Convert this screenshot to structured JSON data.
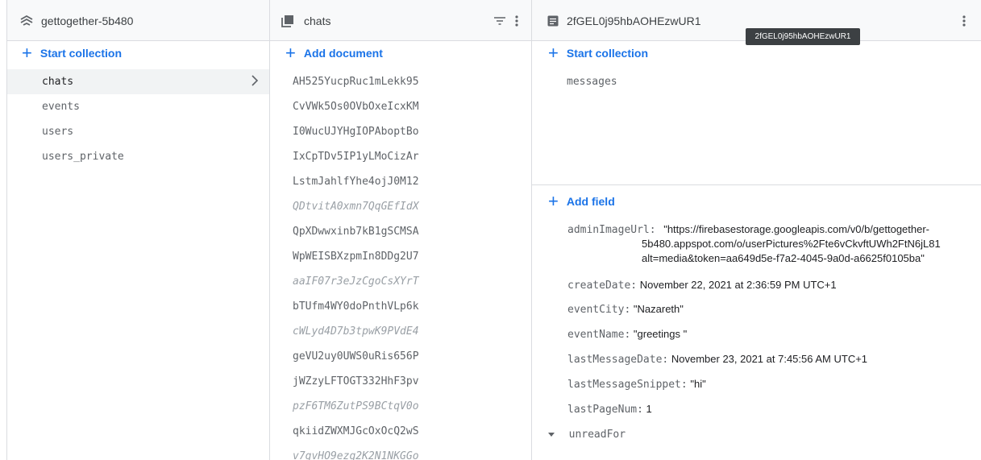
{
  "project": {
    "name": "gettogether-5b480"
  },
  "collections_panel": {
    "start_collection_label": "Start collection",
    "items": [
      {
        "label": "chats",
        "active": true
      },
      {
        "label": "events"
      },
      {
        "label": "users"
      },
      {
        "label": "users_private"
      }
    ]
  },
  "documents_panel": {
    "title": "chats",
    "add_document_label": "Add document",
    "items": [
      {
        "id": "AH525YucpRuc1mLekk95"
      },
      {
        "id": "CvVWk5Os0OVbOxeIcxKM"
      },
      {
        "id": "I0WucUJYHgIOPAboptBo"
      },
      {
        "id": "IxCpTDv5IP1yLMoCizAr"
      },
      {
        "id": "LstmJahlfYhe4ojJ0M12"
      },
      {
        "id": "QDtvitA0xmn7QqGEfIdX",
        "missing": true
      },
      {
        "id": "QpXDwwxinb7kB1gSCMSA"
      },
      {
        "id": "WpWEISBXzpmIn8DDg2U7"
      },
      {
        "id": "aaIF07r3eJzCgoCsXYrT",
        "missing": true
      },
      {
        "id": "bTUfm4WY0doPnthVLp6k"
      },
      {
        "id": "cWLyd4D7b3tpwK9PVdE4",
        "missing": true
      },
      {
        "id": "geVU2uy0UWS0uRis656P"
      },
      {
        "id": "jWZzyLFTOGT332HhF3pv"
      },
      {
        "id": "pzF6TM6ZutPS9BCtqV0o",
        "missing": true
      },
      {
        "id": "qkiidZWXMJGcOxOcQ2wS"
      },
      {
        "id": "v7gvHO9ezg2K2N1NKGGo",
        "missing": true
      }
    ]
  },
  "document_panel": {
    "title": "2fGEL0j95hbAOHEzwUR1",
    "tooltip": "2fGEL0j95hbAOHEzwUR1",
    "start_collection_label": "Start collection",
    "subcollections": [
      "messages"
    ],
    "add_field_label": "Add field",
    "fields": {
      "adminImageUrl": {
        "key": "adminImageUrl:",
        "line1": "\"https://firebasestorage.googleapis.com/v0/b/gettogether-",
        "line2": "5b480.appspot.com/o/userPictures%2Fte6vCkvftUWh2FtN6jL81",
        "line3": "alt=media&token=aa649d5e-f7a2-4045-9a0d-a6625f0105ba\""
      },
      "createDate": {
        "key": "createDate:",
        "value": "November 22, 2021 at 2:36:59 PM UTC+1"
      },
      "eventCity": {
        "key": "eventCity:",
        "value": "\"Nazareth\""
      },
      "eventName": {
        "key": "eventName:",
        "value": "\"greetings \""
      },
      "lastMessageDate": {
        "key": "lastMessageDate:",
        "value": "November 23, 2021 at 7:45:56 AM UTC+1"
      },
      "lastMessageSnippet": {
        "key": "lastMessageSnippet:",
        "value": "\"hi\""
      },
      "lastPageNum": {
        "key": "lastPageNum:",
        "value": "1"
      },
      "unreadFor": {
        "key": "unreadFor"
      }
    }
  }
}
